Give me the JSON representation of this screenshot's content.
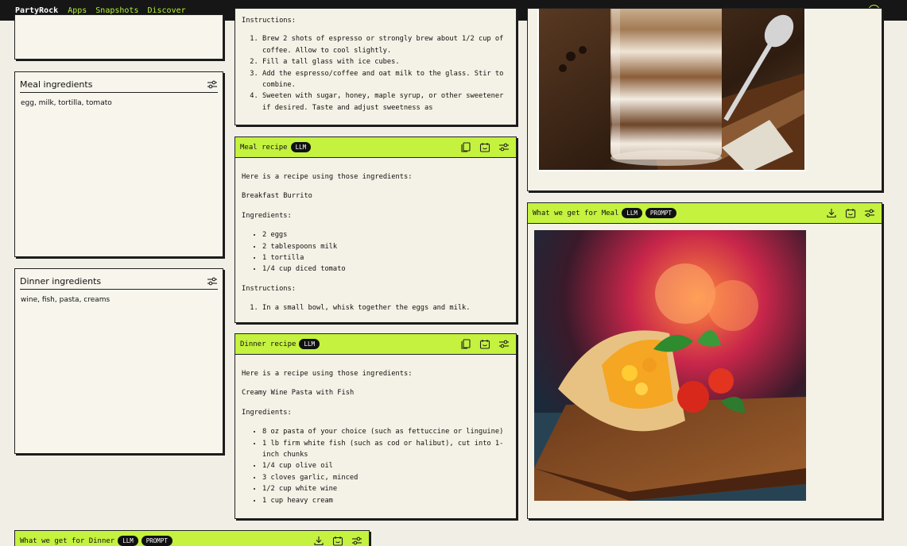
{
  "topbar": {
    "brand": "PartyRock",
    "nav": [
      "Apps",
      "Snapshots",
      "Discover"
    ]
  },
  "colors": {
    "accent": "#c4f23f",
    "dark": "#161616",
    "background": "#f1efe5"
  },
  "inputs": {
    "meal": {
      "title": "Meal ingredients",
      "value": "egg, milk, tortilla, tomato"
    },
    "dinner": {
      "title": "Dinner ingredients",
      "value": "wine, fish, pasta, creams"
    }
  },
  "coffee_recipe": {
    "heading": "Instructions:",
    "steps": [
      "Brew 2 shots of espresso or strongly brew about 1/2 cup of coffee. Allow to cool slightly.",
      "Fill a tall glass with ice cubes.",
      "Add the espresso/coffee and oat milk to the glass. Stir to combine.",
      "Sweeten with sugar, honey, maple syrup, or other sweetener if desired. Taste and adjust sweetness as"
    ]
  },
  "meal_recipe": {
    "title": "Meal recipe",
    "badge": "LLM",
    "intro": "Here is a recipe using those ingredients:",
    "name": "Breakfast Burrito",
    "ingredients_heading": "Ingredients:",
    "ingredients": [
      "2 eggs",
      "2 tablespoons milk",
      "1 tortilla",
      "1/4 cup diced tomato"
    ],
    "instructions_heading": "Instructions:",
    "steps": [
      "In a small bowl, whisk together the eggs and milk."
    ]
  },
  "dinner_recipe": {
    "title": "Dinner recipe",
    "badge": "LLM",
    "intro": "Here is a recipe using those ingredients:",
    "name": "Creamy Wine Pasta with Fish",
    "ingredients_heading": "Ingredients:",
    "ingredients": [
      "8 oz pasta of your choice (such as fettuccine or linguine)",
      "1 lb firm white fish (such as cod or halibut), cut into 1-inch chunks",
      "1/4 cup olive oil",
      "3 cloves garlic, minced",
      "1/2 cup white wine",
      "1 cup heavy cream"
    ]
  },
  "meal_image": {
    "title": "What we get for Meal",
    "badges": [
      "LLM",
      "PROMPT"
    ]
  },
  "dinner_image": {
    "title": "What we get for Dinner",
    "badges": [
      "LLM",
      "PROMPT"
    ]
  },
  "icons": [
    "smiley-icon",
    "copy-icon",
    "snapshot-icon",
    "settings-sliders-icon",
    "download-icon"
  ]
}
